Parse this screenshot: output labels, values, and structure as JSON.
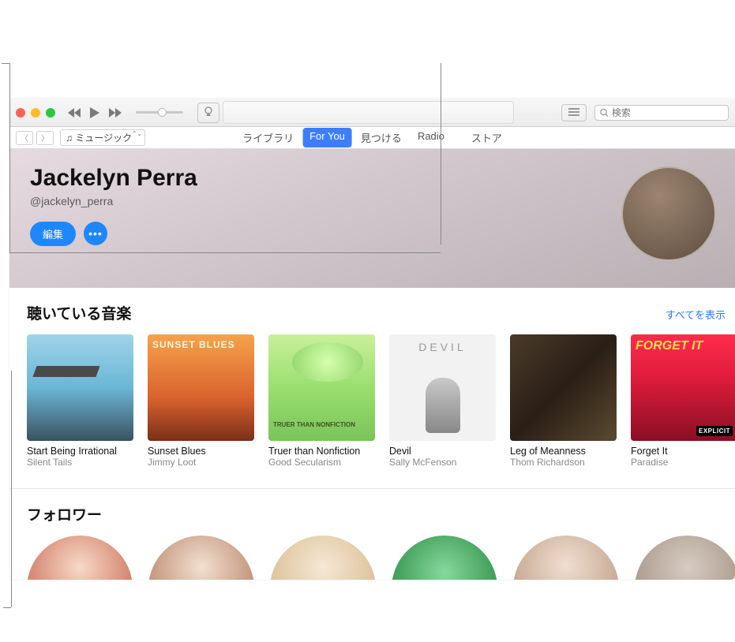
{
  "titlebar": {
    "search_placeholder": "検索"
  },
  "nav": {
    "source_selector": "ミュージック",
    "tabs": {
      "library": "ライブラリ",
      "for_you": "For You",
      "browse": "見つける",
      "radio": "Radio",
      "store": "ストア"
    }
  },
  "profile": {
    "display_name": "Jackelyn Perra",
    "handle": "@jackelyn_perra",
    "edit_label": "編集"
  },
  "listening": {
    "section_title": "聴いている音楽",
    "see_all": "すべてを表示",
    "albums": [
      {
        "title": "Start Being Irrational",
        "artist": "Silent Tails"
      },
      {
        "title": "Sunset Blues",
        "artist": "Jimmy Loot"
      },
      {
        "title": "Truer than Nonfiction",
        "artist": "Good Secularism"
      },
      {
        "title": "Devil",
        "artist": "Sally McFenson"
      },
      {
        "title": "Leg of Meanness",
        "artist": "Thom Richardson"
      },
      {
        "title": "Forget It",
        "artist": "Paradise"
      }
    ]
  },
  "followers": {
    "section_title": "フォロワー"
  }
}
